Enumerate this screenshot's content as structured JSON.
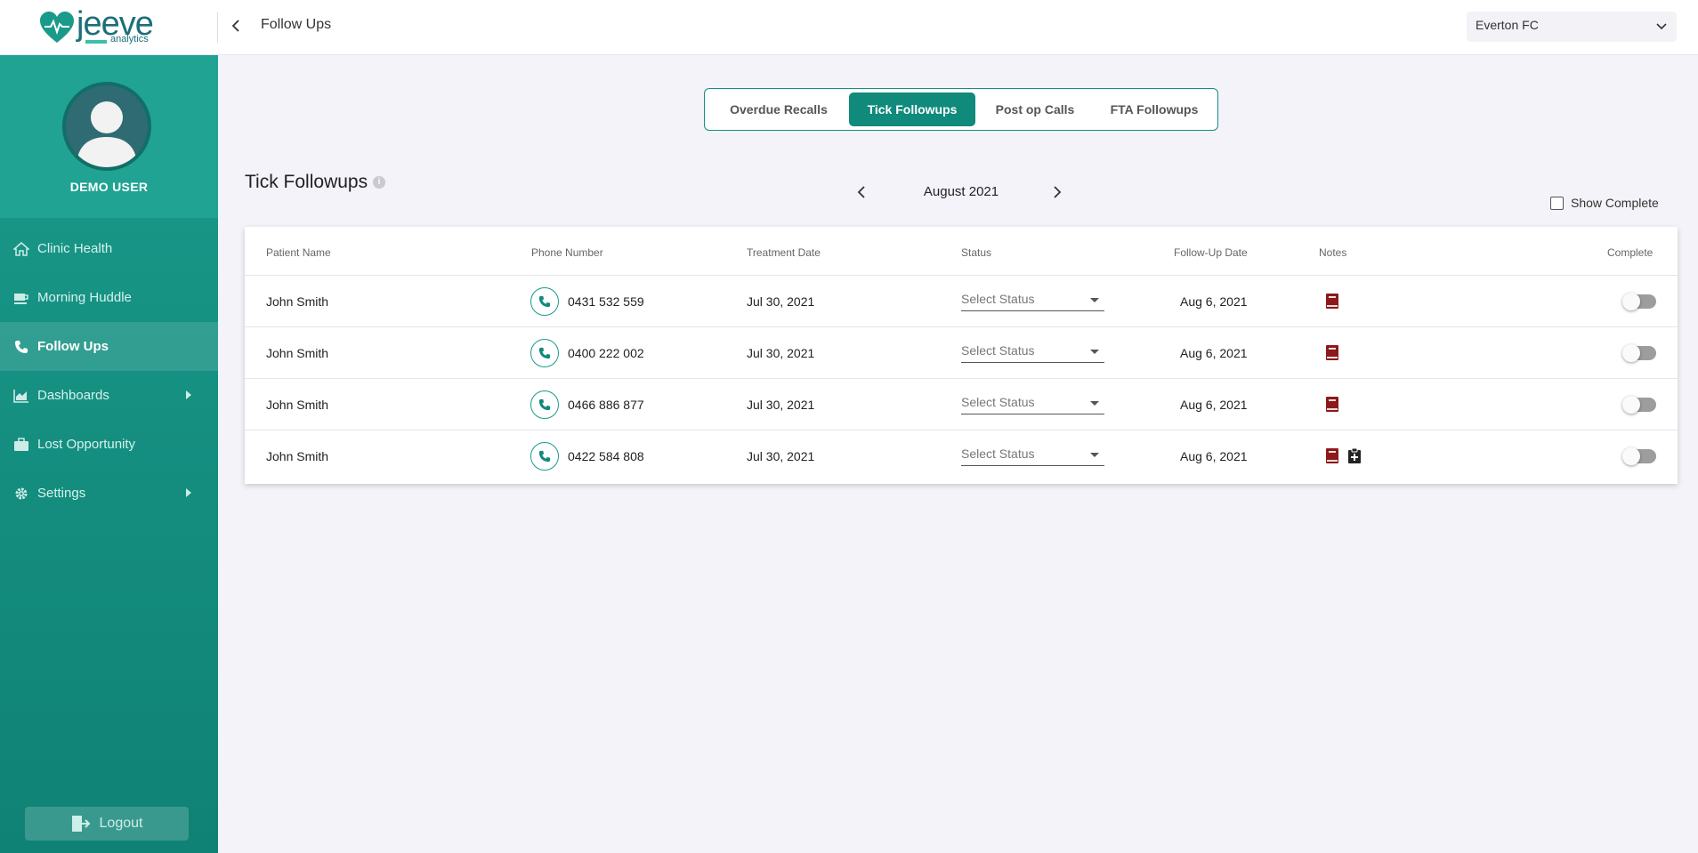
{
  "brand": {
    "name": "jeeve",
    "sub": "analytics"
  },
  "header": {
    "title": "Follow Ups",
    "clinic": "Everton FC"
  },
  "user": {
    "name": "DEMO USER"
  },
  "sidebar": {
    "items": [
      {
        "label": "Clinic Health",
        "icon": "home-icon"
      },
      {
        "label": "Morning Huddle",
        "icon": "coffee-icon"
      },
      {
        "label": "Follow Ups",
        "icon": "phone-icon",
        "active": true
      },
      {
        "label": "Dashboards",
        "icon": "chart-icon",
        "has_submenu": true
      },
      {
        "label": "Lost Opportunity",
        "icon": "briefcase-icon"
      },
      {
        "label": "Settings",
        "icon": "gear-icon",
        "has_submenu": true
      }
    ],
    "logout_label": "Logout"
  },
  "tabs": [
    {
      "label": "Overdue Recalls"
    },
    {
      "label": "Tick Followups",
      "active": true
    },
    {
      "label": "Post op Calls"
    },
    {
      "label": "FTA Followups"
    }
  ],
  "section": {
    "title": "Tick Followups",
    "month": "August 2021",
    "show_complete_label": "Show Complete"
  },
  "table": {
    "columns": [
      "Patient Name",
      "Phone Number",
      "Treatment Date",
      "Status",
      "Follow-Up Date",
      "Notes",
      "Complete"
    ],
    "rows": [
      {
        "patient": "John Smith",
        "phone": "0431 532 559",
        "treatment_date": "Jul 30, 2021",
        "status": "Select Status",
        "followup_date": "Aug 6, 2021",
        "extra_note": false
      },
      {
        "patient": "John Smith",
        "phone": "0400 222 002",
        "treatment_date": "Jul 30, 2021",
        "status": "Select Status",
        "followup_date": "Aug 6, 2021",
        "extra_note": false
      },
      {
        "patient": "John Smith",
        "phone": "0466 886 877",
        "treatment_date": "Jul 30, 2021",
        "status": "Select Status",
        "followup_date": "Aug 6, 2021",
        "extra_note": false
      },
      {
        "patient": "John Smith",
        "phone": "0422 584 808",
        "treatment_date": "Jul 30, 2021",
        "status": "Select Status",
        "followup_date": "Aug 6, 2021",
        "extra_note": true
      }
    ]
  },
  "colors": {
    "accent": "#0f8a7b",
    "note": "#8b1a1a"
  }
}
